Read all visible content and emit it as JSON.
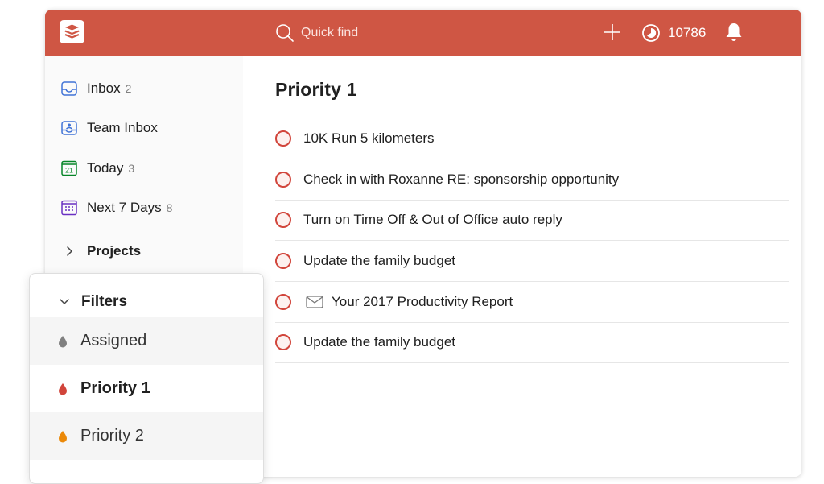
{
  "header": {
    "search_placeholder": "Quick find",
    "karma_points": "10786",
    "background_color": "#cf5644"
  },
  "sidebar": {
    "items": [
      {
        "label": "Inbox",
        "count": "2",
        "icon": "inbox-icon"
      },
      {
        "label": "Team Inbox",
        "count": "",
        "icon": "team-inbox-icon"
      },
      {
        "label": "Today",
        "count": "3",
        "icon": "calendar-today-icon",
        "icon_text": "21"
      },
      {
        "label": "Next 7 Days",
        "count": "8",
        "icon": "calendar-week-icon"
      }
    ],
    "projects_label": "Projects"
  },
  "filters_panel": {
    "title": "Filters",
    "items": [
      {
        "label": "Assigned",
        "color": "#808080"
      },
      {
        "label": "Priority 1",
        "color": "#d1453b",
        "active": true
      },
      {
        "label": "Priority 2",
        "color": "#eb8909"
      }
    ]
  },
  "main": {
    "title": "Priority 1",
    "tasks": [
      {
        "text": "10K Run 5 kilometers"
      },
      {
        "text": "Check in with Roxanne RE: sponsorship opportunity"
      },
      {
        "text": "Turn on Time Off & Out of Office auto reply"
      },
      {
        "text": "Update the family budget"
      },
      {
        "text": "Your 2017 Productivity Report",
        "icon": "mail-icon"
      },
      {
        "text": "Update the family budget"
      }
    ]
  },
  "colors": {
    "accent": "#cf5644",
    "priority1": "#d1453b",
    "priority2": "#eb8909",
    "sidebar_icon": "#4073d6",
    "today_icon": "#058527",
    "week_icon": "#692fc2"
  }
}
